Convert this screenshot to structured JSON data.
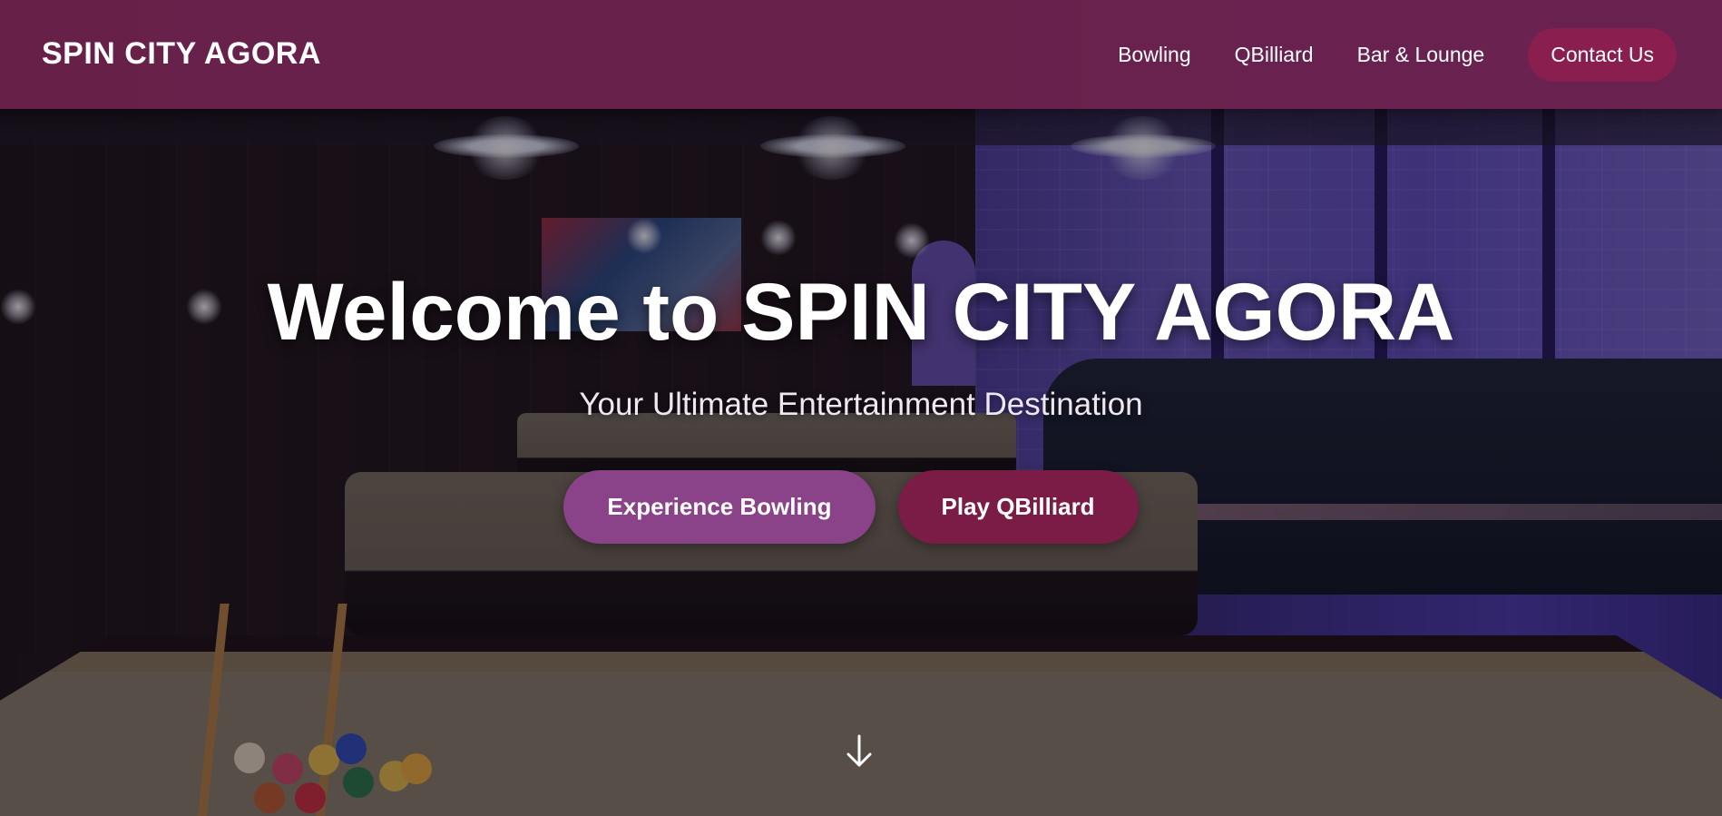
{
  "nav": {
    "brand": "SPIN CITY AGORA",
    "links": [
      {
        "label": "Bowling"
      },
      {
        "label": "QBilliard"
      },
      {
        "label": "Bar & Lounge"
      }
    ],
    "contact_label": "Contact Us"
  },
  "hero": {
    "title": "Welcome to SPIN CITY AGORA",
    "subtitle": "Your Ultimate Entertainment Destination",
    "primary_cta": "Experience Bowling",
    "secondary_cta": "Play QBilliard",
    "scroll_icon": "arrow-down-icon"
  },
  "colors": {
    "navbar": "#6f234e",
    "contact_button": "#8a1e4e",
    "cta_bowling": "#8a4288",
    "cta_billiard": "#7a1c46",
    "text": "#ffffff"
  }
}
